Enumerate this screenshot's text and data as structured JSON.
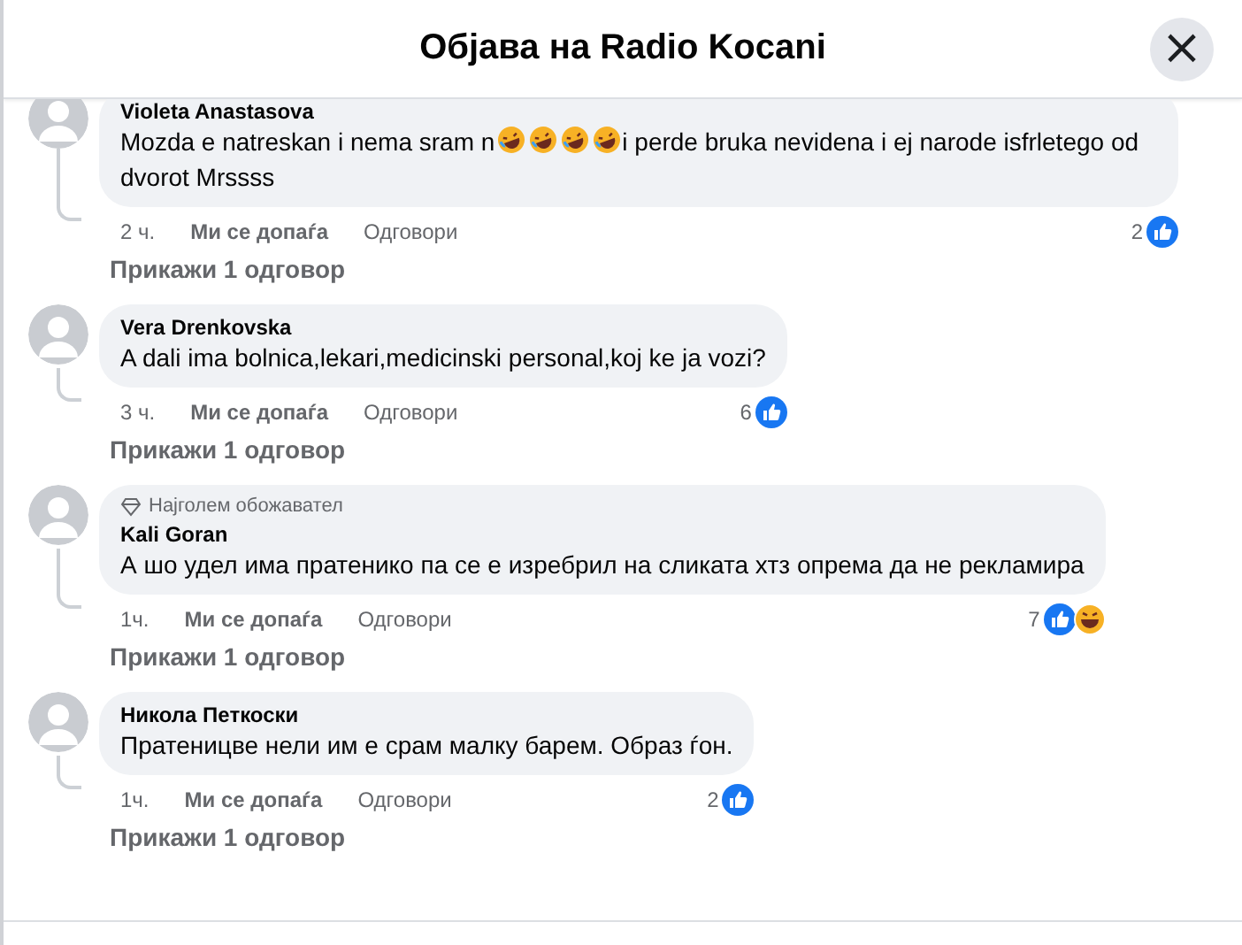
{
  "header": {
    "title": "Објава на Radio Kocani",
    "close": "×"
  },
  "comments": [
    {
      "author": "Violeta Anastasova",
      "segments": [
        {
          "kind": "text",
          "text": "Mozda e natreskan i nema sram n"
        },
        {
          "kind": "emoji"
        },
        {
          "kind": "emoji"
        },
        {
          "kind": "emoji"
        },
        {
          "kind": "emoji"
        },
        {
          "kind": "text",
          "text": "i perde bruka nevidena i ej narode isfrletego od dvorot Mrssss"
        }
      ],
      "time": "2 ч.",
      "like": "Ми се допаѓа",
      "reply": "Одговори",
      "count": "2",
      "reactions": [
        {
          "kind": "like"
        }
      ],
      "replies": "Прикажи 1 одговор"
    },
    {
      "author": "Vera Drenkovska",
      "segments": [
        {
          "kind": "text",
          "text": "A dali ima bolnica,lekari,medicinski personal,koj ke ja vozi?"
        }
      ],
      "time": "3 ч.",
      "like": "Ми се допаѓа",
      "reply": "Одговори",
      "count": "6",
      "reactions": [
        {
          "kind": "like"
        }
      ],
      "replies": "Прикажи 1 одговор"
    },
    {
      "author": "Kali Goran",
      "badge": "Најголем обожавател",
      "segments": [
        {
          "kind": "text",
          "text": "А шо удел има пратенико па се е изребрил на сликата хтз опрема да не рекламира"
        }
      ],
      "time": "1ч.",
      "like": "Ми се допаѓа",
      "reply": "Одговори",
      "count": "7",
      "reactions": [
        {
          "kind": "like"
        },
        {
          "kind": "haha"
        }
      ],
      "replies": "Прикажи 1 одговор"
    },
    {
      "author": "Никола Петкоски",
      "segments": [
        {
          "kind": "text",
          "text": "Пратеницве нели им е срам малку барем. Образ ѓон."
        }
      ],
      "time": "1ч.",
      "like": "Ми се допаѓа",
      "reply": "Одговори",
      "count": "2",
      "reactions": [
        {
          "kind": "like"
        }
      ],
      "replies": "Прикажи 1 одговор"
    }
  ]
}
